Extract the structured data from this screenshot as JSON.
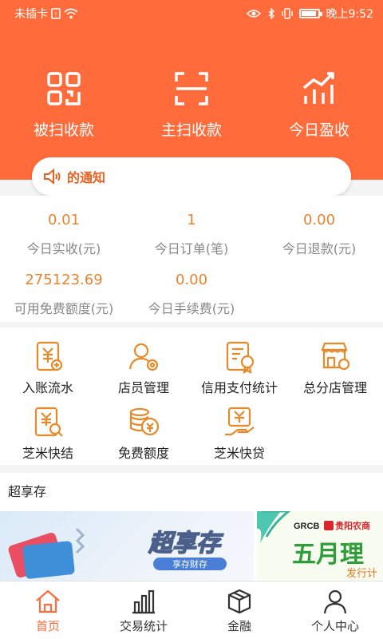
{
  "status_bar": {
    "carrier": "未插卡",
    "time": "晚上9:52"
  },
  "header": {
    "actions": [
      {
        "label": "被扫收款",
        "icon": "qr-code-icon"
      },
      {
        "label": "主扫收款",
        "icon": "scan-icon"
      },
      {
        "label": "今日盈收",
        "icon": "bar-chart-icon"
      }
    ],
    "notice": {
      "text": "的通知",
      "icon": "speaker-icon"
    }
  },
  "stats": [
    {
      "value": "0.01",
      "label": "今日实收(元)"
    },
    {
      "value": "1",
      "label": "今日订单(笔)"
    },
    {
      "value": "0.00",
      "label": "今日退款(元)"
    },
    {
      "value": "275123.69",
      "label": "可用免费额度(元)"
    },
    {
      "value": "0.00",
      "label": "今日手续费(元)"
    }
  ],
  "menu": [
    {
      "label": "入账流水",
      "icon": "ledger-icon"
    },
    {
      "label": "店员管理",
      "icon": "staff-icon"
    },
    {
      "label": "信用支付统计",
      "icon": "credit-report-icon"
    },
    {
      "label": "总分店管理",
      "icon": "store-icon"
    },
    {
      "label": "芝米快结",
      "icon": "quick-settle-icon"
    },
    {
      "label": "免费额度",
      "icon": "coins-icon"
    },
    {
      "label": "芝米快贷",
      "icon": "loan-icon"
    }
  ],
  "chaoxiang": {
    "title": "超享存",
    "banner1": {
      "headline": "超享存",
      "sub": "享存财存"
    },
    "banner2": {
      "brand": "GRCB",
      "bank": "贵阳农商",
      "headline": "五月理",
      "sub": "发行计"
    }
  },
  "tabbar": [
    {
      "label": "首页",
      "icon": "home-icon",
      "active": true
    },
    {
      "label": "交易统计",
      "icon": "stats-icon",
      "active": false
    },
    {
      "label": "金融",
      "icon": "cube-icon",
      "active": false
    },
    {
      "label": "个人中心",
      "icon": "person-icon",
      "active": false
    }
  ],
  "colors": {
    "brand": "#ff6b3a",
    "value": "#e8832f",
    "notice": "#e8611f"
  }
}
